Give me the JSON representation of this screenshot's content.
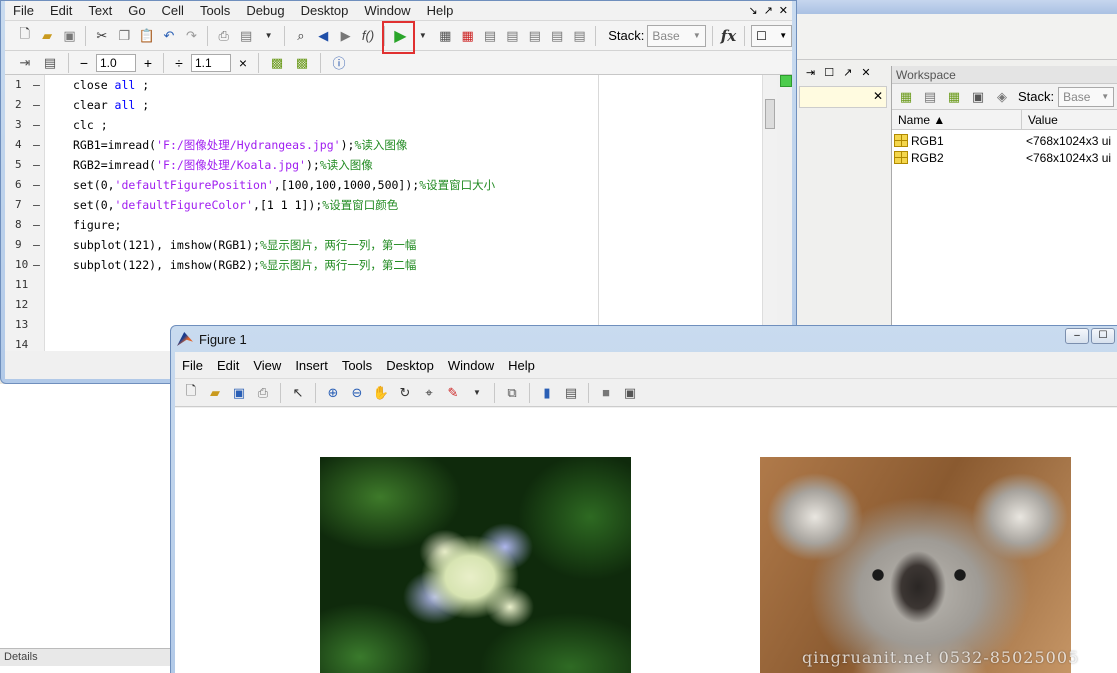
{
  "editor": {
    "menu": [
      "File",
      "Edit",
      "Text",
      "Go",
      "Cell",
      "Tools",
      "Debug",
      "Desktop",
      "Window",
      "Help"
    ],
    "stack_label": "Stack:",
    "stack_value": "Base",
    "fx_label": "fx",
    "cell_minus": "−",
    "cell_value1": "1.0",
    "cell_plus": "+",
    "cell_div": "÷",
    "cell_value2": "1.1",
    "cell_times": "×",
    "lines": [
      {
        "n": "1",
        "dash": "–"
      },
      {
        "n": "2",
        "dash": "–"
      },
      {
        "n": "3",
        "dash": "–"
      },
      {
        "n": "4",
        "dash": "–"
      },
      {
        "n": "5",
        "dash": "–"
      },
      {
        "n": "6",
        "dash": "–"
      },
      {
        "n": "7",
        "dash": "–"
      },
      {
        "n": "8",
        "dash": "–"
      },
      {
        "n": "9",
        "dash": "–"
      },
      {
        "n": "10",
        "dash": "–"
      },
      {
        "n": "11",
        "dash": ""
      },
      {
        "n": "12",
        "dash": ""
      },
      {
        "n": "13",
        "dash": ""
      },
      {
        "n": "14",
        "dash": ""
      }
    ],
    "code": {
      "l1a": "close ",
      "l1b": "all",
      "l1c": " ;",
      "l2a": "clear ",
      "l2b": "all",
      "l2c": " ;",
      "l3": "clc ;",
      "l4a": "RGB1=imread(",
      "l4b": "'F:/图像处理/Hydrangeas.jpg'",
      "l4c": ");",
      "l4d": "%读入图像",
      "l5a": "RGB2=imread(",
      "l5b": "'F:/图像处理/Koala.jpg'",
      "l5c": ");",
      "l5d": "%读入图像",
      "l6a": "set(0,",
      "l6b": "'defaultFigurePosition'",
      "l6c": ",[100,100,1000,500]);",
      "l6d": "%设置窗口大小",
      "l7a": "set(0,",
      "l7b": "'defaultFigureColor'",
      "l7c": ",[1 1 1]);",
      "l7d": "%设置窗口颜色",
      "l8": "figure;",
      "l9a": "subplot(121), imshow(RGB1);",
      "l9b": "%显示图片，两行一列，第一幅",
      "l10a": "subplot(122), imshow(RGB2);",
      "l10b": "%显示图片，两行一列，第二幅"
    }
  },
  "workspace": {
    "title": "Workspace",
    "stack_label": "Stack:",
    "stack_value": "Base",
    "col_name": "Name ▲",
    "col_value": "Value",
    "rows": [
      {
        "name": "RGB1",
        "value": "<768x1024x3 ui"
      },
      {
        "name": "RGB2",
        "value": "<768x1024x3 ui"
      }
    ]
  },
  "details_label": "Details",
  "figure": {
    "title": "Figure 1",
    "menu": [
      "File",
      "Edit",
      "View",
      "Insert",
      "Tools",
      "Desktop",
      "Window",
      "Help"
    ],
    "watermark": "qingruanit.net 0532-85025005"
  },
  "colors": {
    "keyword": "#0000ff",
    "string": "#a020f0",
    "comment": "#228b22",
    "highlight_box": "#e03030"
  }
}
